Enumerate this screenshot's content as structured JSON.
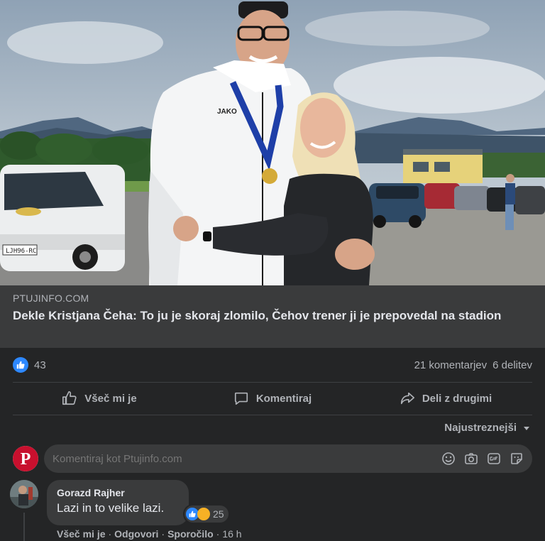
{
  "link": {
    "domain": "PTUJINFO.COM",
    "title": "Dekle Kristjana Čeha: To ju je skoraj zlomilo, Čehov trener ji je prepovedal na stadion"
  },
  "photo": {
    "jacket_brand": "JAKO",
    "car_plate": "LJH96-RC"
  },
  "stats": {
    "reaction_count": "43",
    "comments": "21 komentarjev",
    "shares": "6 delitev"
  },
  "actions": {
    "like": "Všeč mi je",
    "comment": "Komentiraj",
    "share": "Deli z drugimi"
  },
  "sort": {
    "label": "Najustreznejši"
  },
  "composer": {
    "avatar_letter": "P",
    "placeholder": "Komentiraj kot Ptujinfo.com",
    "icons": [
      "smiley-icon",
      "camera-icon",
      "gif-icon",
      "sticker-icon"
    ]
  },
  "comment": {
    "author": "Gorazd Rajher",
    "text": "Lazi in to velike lazi.",
    "reaction_count": "25",
    "like": "Všeč mi je",
    "reply": "Odgovori",
    "message": "Sporočilo",
    "time": "16 h",
    "sep": "·"
  },
  "colors": {
    "background": "#18191a",
    "card": "#242526",
    "link_card": "#3a3b3c",
    "accent": "#2d88ff",
    "secondary_text": "#b0b3b8",
    "page_logo": "#c8102e"
  }
}
